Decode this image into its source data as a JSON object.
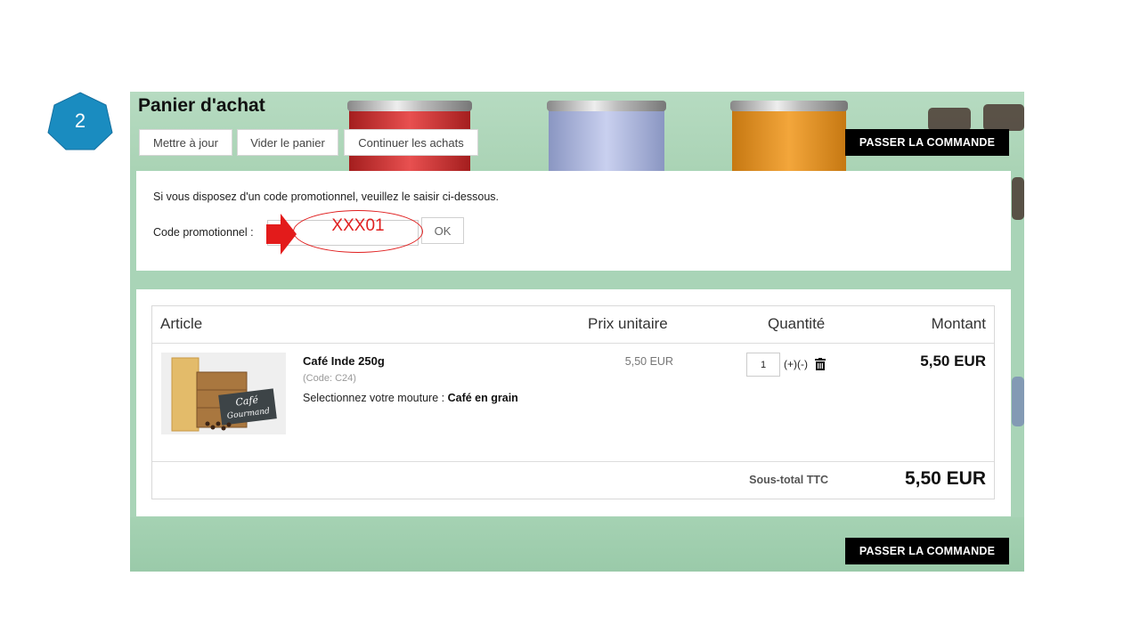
{
  "step": {
    "number": "2",
    "color": "#1a8cc0"
  },
  "cart": {
    "title": "Panier d'achat",
    "buttons": {
      "update": "Mettre à jour",
      "empty": "Vider le panier",
      "continue": "Continuer les achats",
      "checkout": "PASSER LA COMMANDE"
    },
    "promo": {
      "info": "Si vous disposez d'un code promotionnel, veuillez le saisir ci-dessous.",
      "label": "Code promotionnel :",
      "value": "XXX01",
      "ok": "OK"
    },
    "table": {
      "headers": {
        "article": "Article",
        "unit_price": "Prix unitaire",
        "quantity": "Quantité",
        "amount": "Montant"
      },
      "rows": [
        {
          "name": "Café Inde 250g",
          "code": "(Code: C24)",
          "option_label": "Selectionnez votre mouture :",
          "option_value": "Café en grain",
          "unit_price": "5,50 EUR",
          "quantity": "1",
          "qty_controls": "(+)(-)",
          "amount": "5,50 EUR",
          "image_text": {
            "line1": "Café",
            "line2": "Gourmand"
          }
        }
      ]
    },
    "subtotal": {
      "label": "Sous-total TTC",
      "value": "5,50 EUR"
    }
  },
  "colors": {
    "annotation": "#e02020",
    "checkout_bg": "#000000",
    "background": "#aad3b5"
  }
}
